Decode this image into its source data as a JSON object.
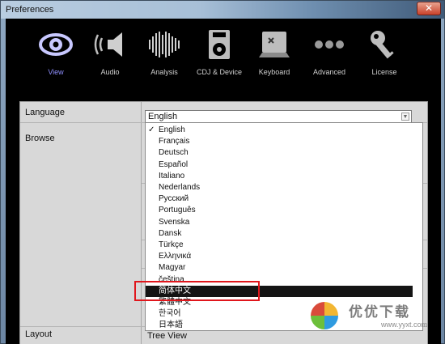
{
  "window": {
    "title": "Preferences",
    "close_glyph": "✕"
  },
  "toolbar": {
    "tabs": [
      {
        "label": "View",
        "icon": "eye-icon",
        "active": true
      },
      {
        "label": "Audio",
        "icon": "speaker-icon"
      },
      {
        "label": "Analysis",
        "icon": "waveform-icon"
      },
      {
        "label": "CDJ & Device",
        "icon": "device-icon"
      },
      {
        "label": "Keyboard",
        "icon": "keyboard-icon"
      },
      {
        "label": "Advanced",
        "icon": "dots-icon"
      },
      {
        "label": "License",
        "icon": "key-icon"
      }
    ]
  },
  "settings": {
    "language_label": "Language",
    "browse_label": "Browse",
    "layout_label": "Layout",
    "layout_value": "Tree View",
    "language_value": "English"
  },
  "language_dropdown": {
    "options": [
      "English",
      "Français",
      "Deutsch",
      "Español",
      "Italiano",
      "Nederlands",
      "Русский",
      "Português",
      "Svenska",
      "Dansk",
      "Türkçe",
      "Ελληνικά",
      "Magyar",
      "čeština",
      "简体中文",
      "繁體中文",
      "한국어",
      "日本語"
    ],
    "checked": "English",
    "checked_glyph": "✓",
    "highlighted": "简体中文"
  },
  "watermark": {
    "text": "优优下载",
    "url": "www.yyxt.com"
  },
  "colors": {
    "accent_active": "#8f8fff",
    "highlight_box": "#e0161c"
  }
}
